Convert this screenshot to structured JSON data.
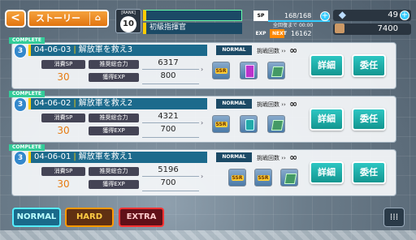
{
  "header": {
    "back_label": "<",
    "title": "ストーリー",
    "home_icon": "⌂",
    "rank_label": "[RANK]",
    "rank_value": "10",
    "player_title": "初級指揮官",
    "sp_label": "SP",
    "sp_value": "168/168",
    "recover_label": "全回復まで",
    "recover_time": "00:00",
    "exp_label": "EXP",
    "next_label": "NEXT",
    "next_value": "16162",
    "gems": "49",
    "gold": "7400"
  },
  "missions": [
    {
      "status": "COMPLETE",
      "badge": "3",
      "code": "04-06-03",
      "name": "解放軍を救え3",
      "difficulty": "NORMAL",
      "limit_label": "挑戦回数",
      "limit_value": "∞",
      "sp_label": "消費SP",
      "sp_cost": "30",
      "power_label": "推奨総合力",
      "power_value": "6317",
      "exp_label": "獲得EXP",
      "exp_value": "800",
      "rewards": [
        "ssr-ticket",
        "book",
        "chip"
      ],
      "detail_label": "詳細",
      "delegate_label": "委任"
    },
    {
      "status": "COMPLETE",
      "badge": "3",
      "code": "04-06-02",
      "name": "解放軍を救え2",
      "difficulty": "NORMAL",
      "limit_label": "挑戦回数",
      "limit_value": "∞",
      "sp_label": "消費SP",
      "sp_cost": "30",
      "power_label": "推奨総合力",
      "power_value": "4321",
      "exp_label": "獲得EXP",
      "exp_value": "700",
      "rewards": [
        "ssr-ticket",
        "jar",
        "chip"
      ],
      "detail_label": "詳細",
      "delegate_label": "委任"
    },
    {
      "status": "COMPLETE",
      "badge": "3",
      "code": "04-06-01",
      "name": "解放軍を救え1",
      "difficulty": "NORMAL",
      "limit_label": "挑戦回数",
      "limit_value": "∞",
      "sp_label": "消費SP",
      "sp_cost": "30",
      "power_label": "推奨総合力",
      "power_value": "5196",
      "exp_label": "獲得EXP",
      "exp_value": "700",
      "rewards": [
        "ssr-ticket",
        "ssr-ticket",
        "chip"
      ],
      "detail_label": "詳細",
      "delegate_label": "委任"
    }
  ],
  "footer": {
    "normal": "NORMAL",
    "hard": "HARD",
    "extra": "EXTRA",
    "menu_icon": "⁞⁞⁞"
  },
  "colors": {
    "accent_orange": "#e27510",
    "title_blue": "#1c6a8c",
    "button_teal": "#139690",
    "complete_green": "#33cc99"
  }
}
